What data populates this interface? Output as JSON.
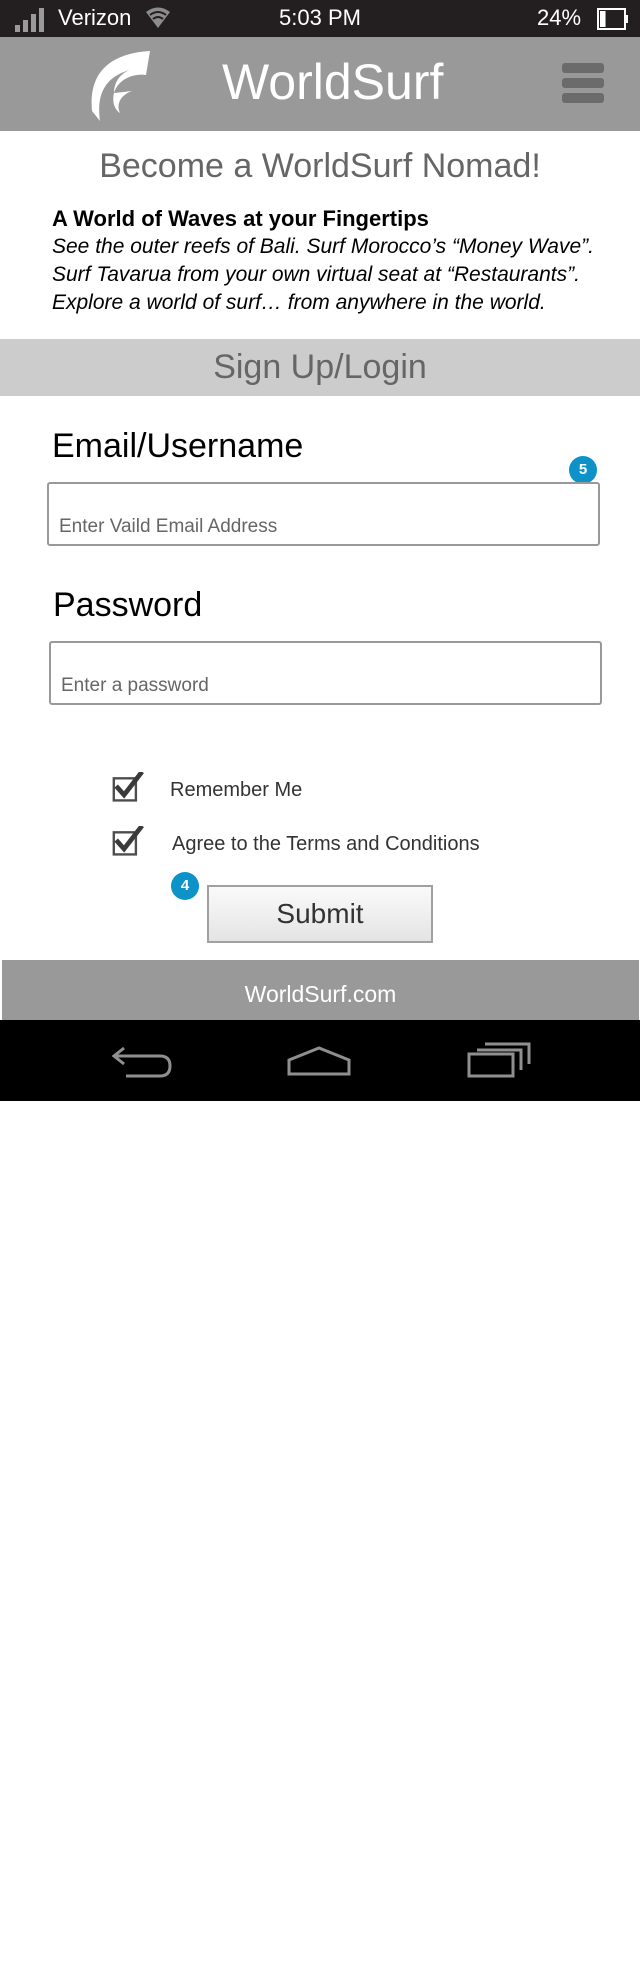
{
  "status_bar": {
    "carrier": "Verizon",
    "time": "5:03 PM",
    "battery": "24%",
    "battery_level": 0.24
  },
  "header": {
    "title": "WorldSurf",
    "logo_icon": "wave-logo-icon",
    "menu_icon": "hamburger-menu-icon"
  },
  "intro": {
    "headline": "Become a WorldSurf Nomad!",
    "title": "A World of Waves at your Fingertips",
    "lines": [
      "See the outer reefs of Bali. Surf Morocco’s “Money Wave”.",
      "Surf Tavarua from your own virtual seat at “Restaurants”.",
      "Explore a world of surf… from anywhere in the world."
    ]
  },
  "section": {
    "title": "Sign Up/Login"
  },
  "form": {
    "email_label": "Email/Username",
    "email_placeholder": "Enter Vaild Email Address",
    "email_value": "",
    "password_label": "Password",
    "password_placeholder": "Enter a password",
    "password_value": "",
    "remember_label": "Remember Me",
    "remember_checked": true,
    "terms_label": "Agree to the Terms and Conditions",
    "terms_checked": true,
    "submit_label": "Submit",
    "badge_email": "5",
    "badge_submit": "4"
  },
  "footer": {
    "link": "WorldSurf.com"
  },
  "nav": {
    "back_icon": "back-icon",
    "home_icon": "home-icon",
    "recents_icon": "recent-apps-icon"
  },
  "colors": {
    "header_bg": "#999999",
    "section_bg": "#cccccc",
    "badge": "#0e93c8",
    "status_bg": "#231f20",
    "nav_bg": "#000000"
  }
}
